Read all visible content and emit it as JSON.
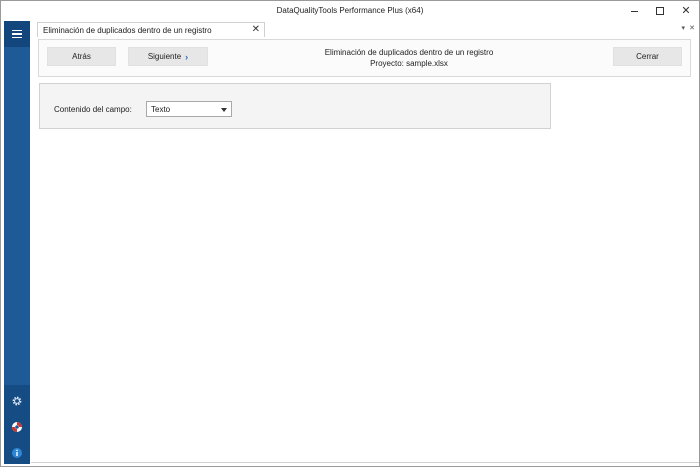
{
  "window": {
    "title": "DataQualityTools Performance Plus (x64)",
    "controls": {
      "minimize": "minimize-icon",
      "maximize": "maximize-icon",
      "close": "close-icon"
    }
  },
  "sidebar": {
    "menu_icon": "hamburger-menu-icon",
    "accent": "#1e5a98",
    "bottom_icons": [
      "gear-icon",
      "lifebuoy-icon",
      "info-icon"
    ]
  },
  "tabs": [
    {
      "label": "Eliminación de duplicados dentro de un registro",
      "close_glyph": "✕"
    }
  ],
  "tabstrip": {
    "dropdown_glyph": "▾",
    "close_glyph": "✕"
  },
  "toolbar": {
    "back_label": "Atrás",
    "next_label": "Siguiente",
    "next_chevron": "›",
    "close_label": "Cerrar",
    "heading": "Eliminación de duplicados dentro de un registro",
    "project": "Proyecto: sample.xlsx"
  },
  "form": {
    "field_label": "Contenido del campo:",
    "field_value": "Texto"
  }
}
